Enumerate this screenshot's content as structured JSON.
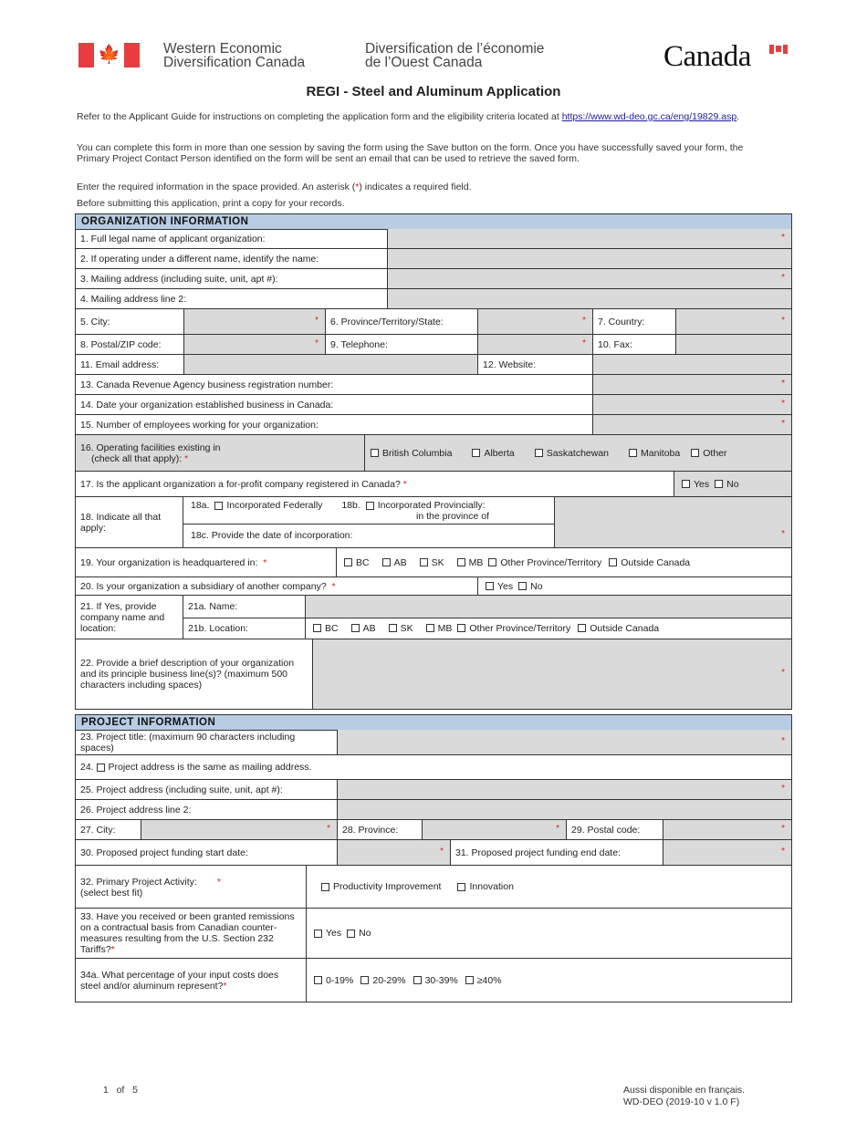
{
  "header": {
    "agency_en_line1": "Western Economic",
    "agency_en_line2": "Diversification Canada",
    "agency_fr_line1": "Diversification de l’économie",
    "agency_fr_line2": "de l’Ouest Canada",
    "wordmark": "Canada",
    "flag_icon": "canada-flag-icon",
    "flag_colors": {
      "red": "#ea3c3f",
      "white": "#ffffff"
    }
  },
  "title": "REGI - Steel and Aluminum Application",
  "intro": {
    "p1_text": "Refer to the Applicant Guide for instructions on completing the application form and the eligibility criteria located at ",
    "p1_link": "https://www.wd-deo.gc.ca/eng/19829.asp",
    "p1_end": ".",
    "p2": "You can complete this form in more than one session by saving the form using the Save button on the form.  Once you have successfully saved your form, the Primary Project Contact Person identified on the form will be sent an email that can be used to retrieve the saved form.",
    "p3_a": "Enter the required information in the space provided.  An asterisk (",
    "p3_star": "*",
    "p3_b": ") indicates a required field.",
    "p4": "Before submitting this application, print a copy for your records."
  },
  "colors": {
    "section_header": "#b8cce4",
    "input_bg": "#dadada",
    "required": "#e02020",
    "link": "#1a1aa8"
  },
  "org": {
    "heading": "ORGANIZATION INFORMATION",
    "q1": "1. Full legal name of applicant organization:",
    "q2": "2. If operating under a different name, identify the name:",
    "q3": "3. Mailing address (including suite, unit, apt #):",
    "q4": "4. Mailing address line 2:",
    "q5": "5. City:",
    "q6": "6. Province/Territory/State:",
    "q7": "7. Country:",
    "q8": "8. Postal/ZIP code:",
    "q9": "9. Telephone:",
    "q10": "10. Fax:",
    "q11": "11. Email address:",
    "q12": "12. Website:",
    "q13": "13. Canada Revenue Agency business registration number:",
    "q14": "14. Date your organization established business in Canada:",
    "q15": "15. Number of employees working for your organization:",
    "q16_line1": "16. Operating facilities existing in",
    "q16_line2": "(check all that apply):",
    "q16_options": [
      "British Columbia",
      "Alberta",
      "Saskatchewan",
      "Manitoba",
      "Other"
    ],
    "q17": "17. Is the applicant organization a for-profit company registered in Canada?",
    "q17_options": [
      "Yes",
      "No"
    ],
    "q18": "18. Indicate all that apply:",
    "q18a_num": "18a.",
    "q18a": "Incorporated Federally",
    "q18b_num": "18b.",
    "q18b_line1": "Incorporated Provincially:",
    "q18b_line2": "in the province of",
    "q18c": "18c. Provide the date of incorporation:",
    "q19": "19. Your organization is headquartered in:",
    "q19_options": [
      "BC",
      "AB",
      "SK",
      "MB",
      "Other Province/Territory",
      "Outside Canada"
    ],
    "q20": "20. Is your organization a subsidiary of another company?",
    "q20_options": [
      "Yes",
      "No"
    ],
    "q21": "21. If Yes, provide company name and location:",
    "q21a": "21a. Name:",
    "q21b": "21b. Location:",
    "q21b_options": [
      "BC",
      "AB",
      "SK",
      "MB",
      "Other Province/Territory",
      "Outside Canada"
    ],
    "q22": "22. Provide a brief description of your organization and its principle business line(s)?  (maximum 500 characters including spaces)"
  },
  "project": {
    "heading": "PROJECT INFORMATION",
    "q23": "23. Project title: (maximum 90 characters including spaces)",
    "q24_num": "24.",
    "q24": "Project address is the same as mailing address.",
    "q25": "25. Project address (including suite, unit, apt #):",
    "q26": "26. Project address line 2:",
    "q27": "27. City:",
    "q28": "28. Province:",
    "q29": "29. Postal code:",
    "q30": "30. Proposed project funding start date:",
    "q31": "31. Proposed project funding end date:",
    "q32_line1": "32. Primary Project Activity:",
    "q32_line2": "(select best fit)",
    "q32_options": [
      "Productivity Improvement",
      "Innovation"
    ],
    "q33": "33. Have you received or been granted remissions on a contractual basis from Canadian counter-measures resulting from the U.S. Section 232 Tariffs?",
    "q33_options": [
      "Yes",
      "No"
    ],
    "q34a": "34a. What percentage of your input costs does steel and/or aluminum represent?",
    "q34a_options": [
      "0-19%",
      "20-29%",
      "30-39%",
      "≥40%"
    ]
  },
  "required_mark": "*",
  "footer": {
    "page": "1   of   5",
    "french": "Aussi disponible en français.",
    "code": "WD-DEO (2019-10 v 1.0 F)"
  }
}
